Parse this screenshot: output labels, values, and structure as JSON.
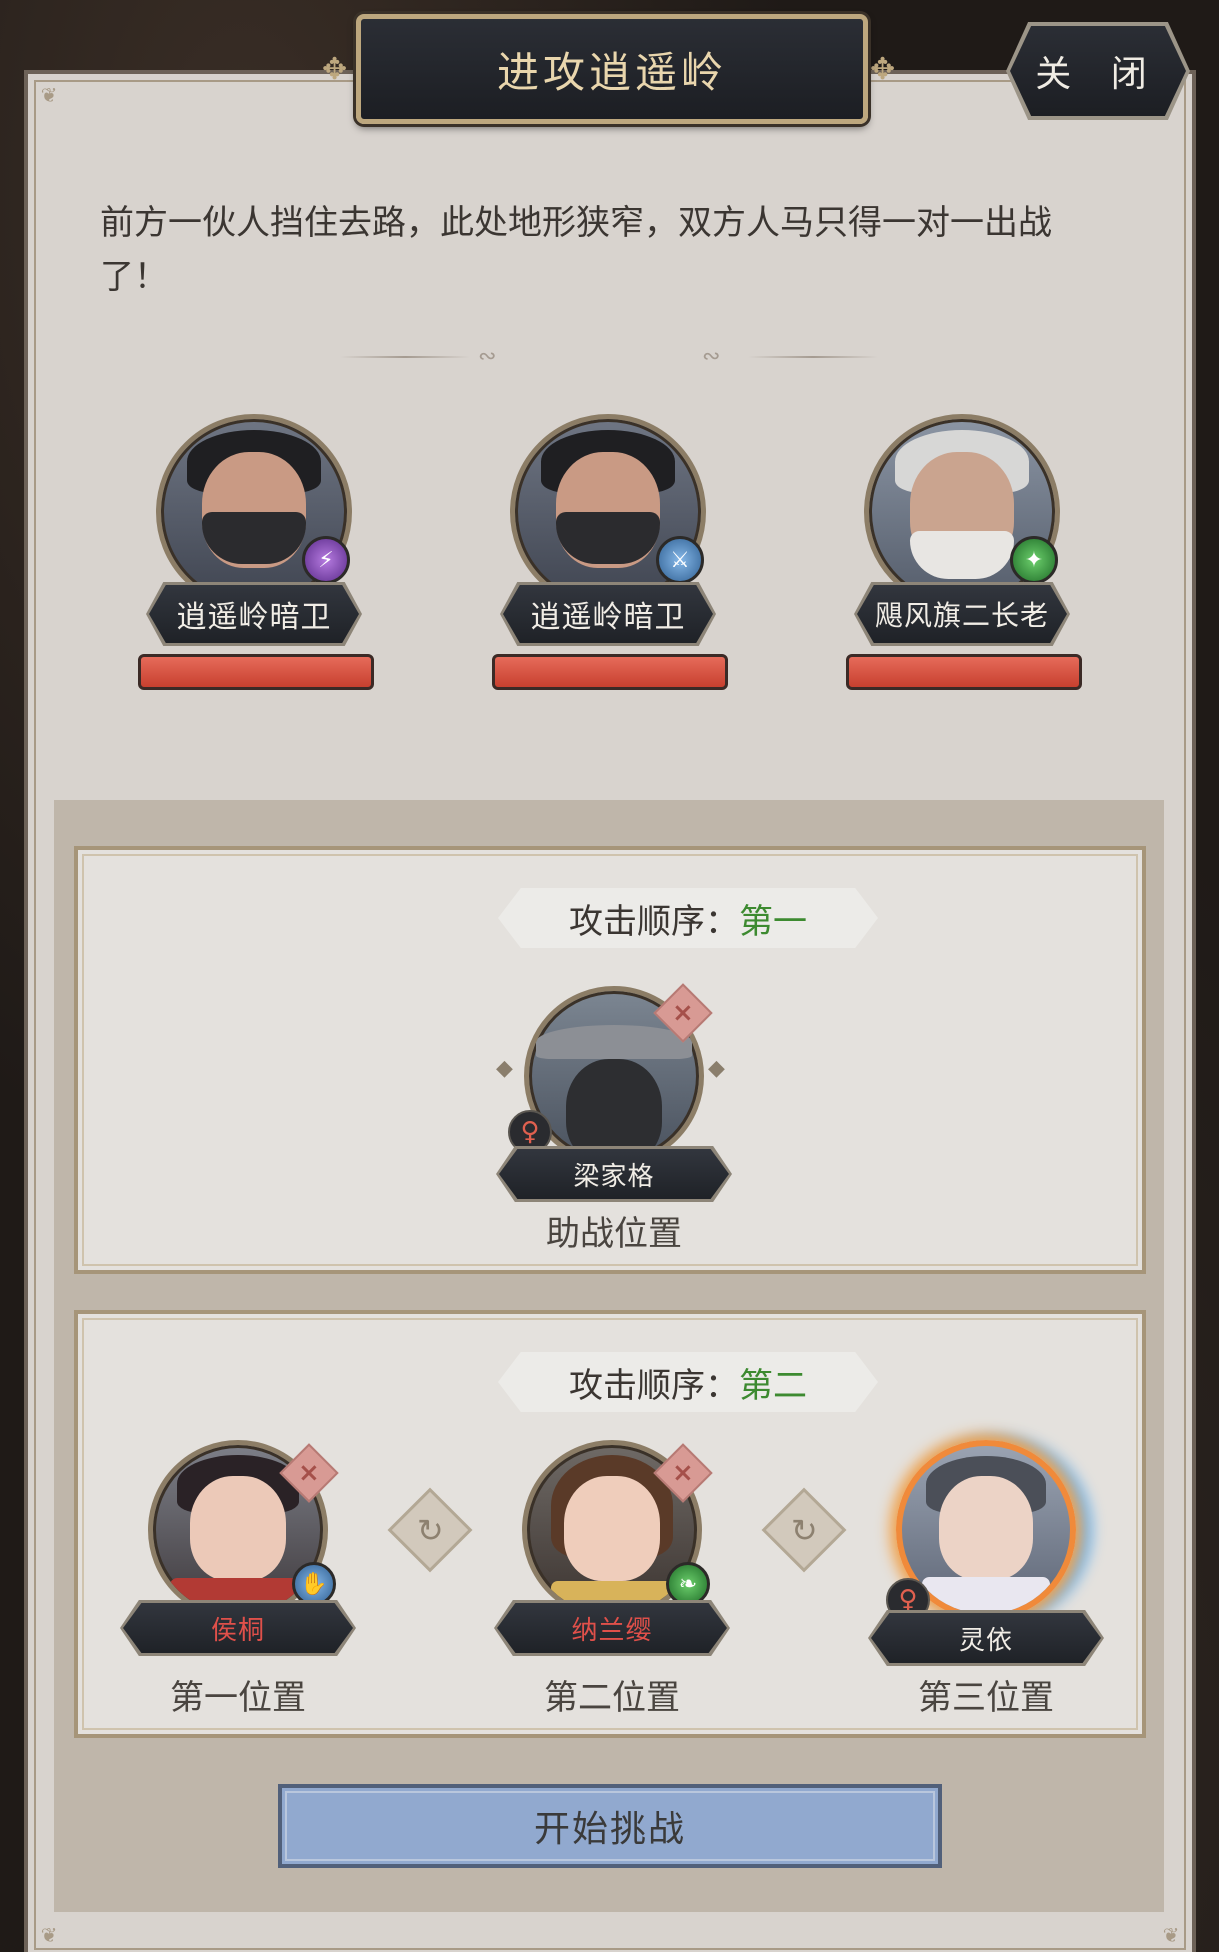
{
  "dialog": {
    "title": "进攻逍遥岭",
    "close_label": "关 闭",
    "intro_text": "前方一伙人挡住去路，此处地形狭窄，双方人马只得一对一出战了！"
  },
  "enemies": [
    {
      "name": "逍遥岭暗卫",
      "hp_fraction": 1.0,
      "icon": "purple-spear-icon"
    },
    {
      "name": "逍遥岭暗卫",
      "hp_fraction": 1.0,
      "icon": "blue-sword-icon"
    },
    {
      "name": "飓风旗二长老",
      "hp_fraction": 1.0,
      "icon": "green-boot-icon"
    }
  ],
  "order_first": {
    "label": "攻击顺序：",
    "value": "第一",
    "slot": {
      "name": "梁家格",
      "position_label": "助战位置",
      "gender_icon": "female-icon"
    }
  },
  "order_second": {
    "label": "攻击顺序：",
    "value": "第二",
    "slots": [
      {
        "name": "侯桐",
        "position_label": "第一位置",
        "name_color": "#e0504a"
      },
      {
        "name": "纳兰缨",
        "position_label": "第二位置",
        "name_color": "#e0504a"
      },
      {
        "name": "灵依",
        "position_label": "第三位置",
        "name_color": "#f1ede6"
      }
    ]
  },
  "start_label": "开始挑战",
  "colors": {
    "accent_green": "#3d8a30",
    "hp_red": "#d9513f",
    "start_blue": "#91a9cf"
  }
}
